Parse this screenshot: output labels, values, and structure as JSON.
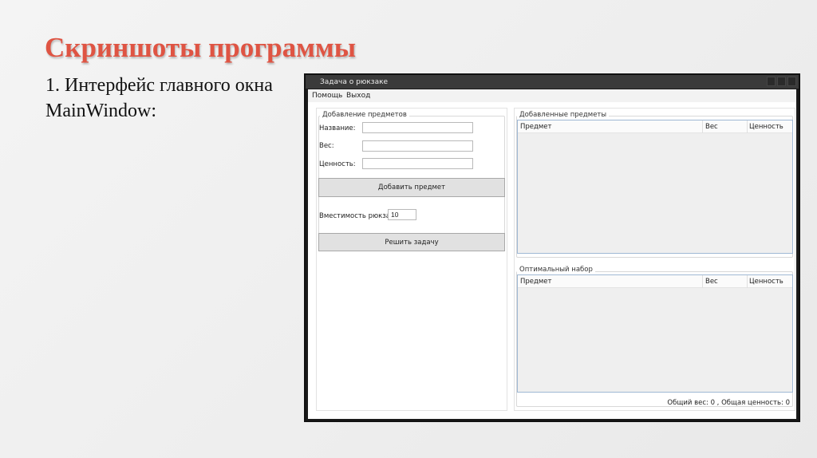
{
  "slide": {
    "title": "Скриншоты программы",
    "body_line1": "1. Интерфейс главного окна",
    "body_line2": "MainWindow:"
  },
  "window": {
    "title": "Задача о рюкзаке",
    "menu": [
      "Помощь",
      "Выход"
    ],
    "add_group": {
      "legend": "Добавление предметов",
      "name_label": "Название:",
      "name_value": "",
      "weight_label": "Вес:",
      "weight_value": "",
      "value_label": "Ценность:",
      "value_value": "",
      "add_button": "Добавить предмет",
      "capacity_label": "Вместимость рюкзака:",
      "capacity_value": "10",
      "solve_button": "Решить задачу"
    },
    "added_group": {
      "legend": "Добавленные предметы",
      "columns": [
        "Предмет",
        "Вес",
        "Ценность"
      ]
    },
    "optimal_group": {
      "legend": "Оптимальный набор",
      "columns": [
        "Предмет",
        "Вес",
        "Ценность"
      ]
    },
    "status": "Общий вес: 0 , Общая ценность: 0"
  }
}
